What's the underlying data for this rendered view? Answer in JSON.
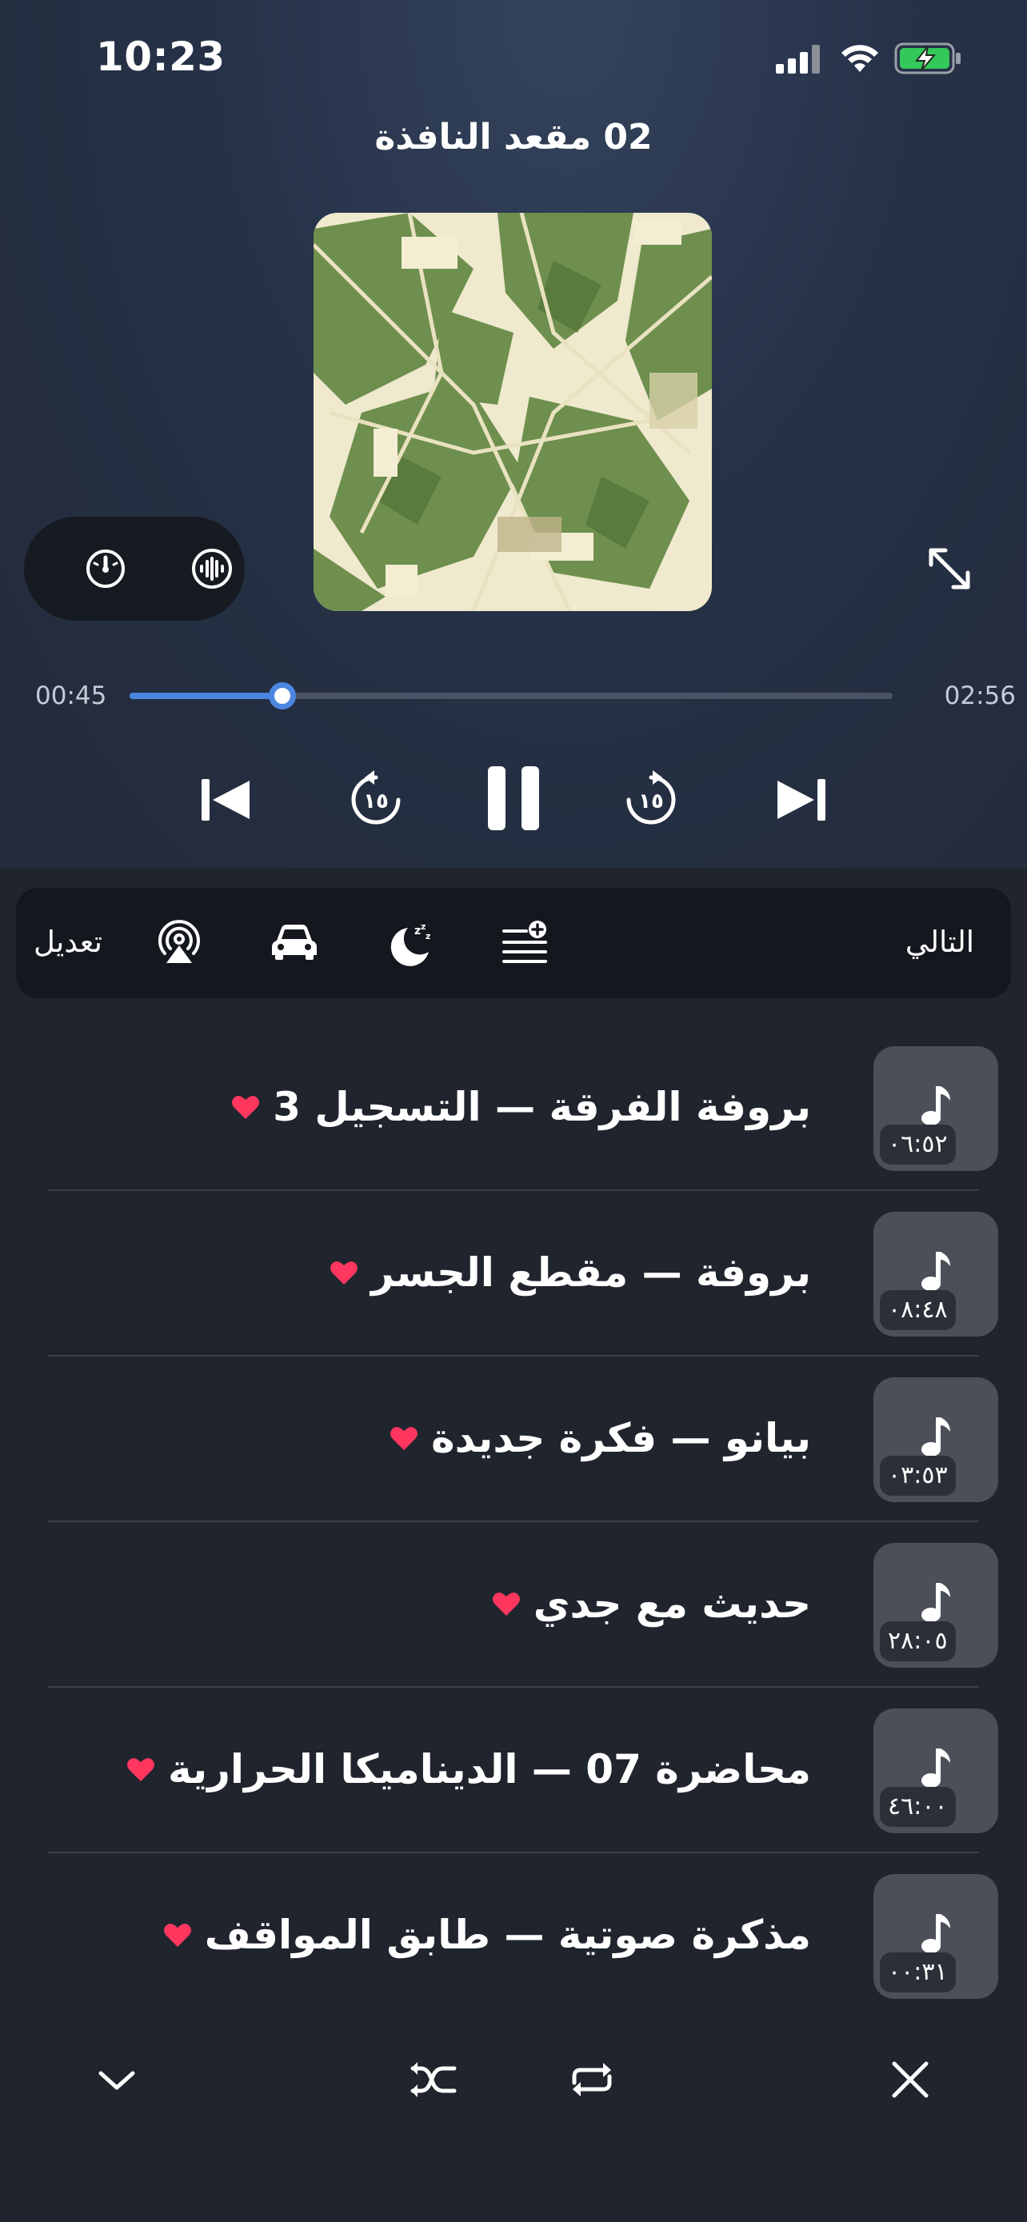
{
  "status_bar": {
    "time": "10:23",
    "battery_status": "charging"
  },
  "player": {
    "track_title": "02 مقعد النافذة",
    "elapsed": "00:45",
    "total": "02:56",
    "progress_fraction": 0.2
  },
  "colors": {
    "accent": "#4b86e0",
    "heart": "#ff375f",
    "battery": "#34c759",
    "toolbar_bg": "#14181e",
    "list_bg": "#1f242d"
  },
  "toolbar": {
    "edit_label": "تعديل",
    "next_label": "التالي",
    "icons": [
      "airplay-icon",
      "car-icon",
      "sleep-timer-icon",
      "add-to-queue-icon"
    ]
  },
  "queue": [
    {
      "title": "بروفة الفرقة — التسجيل 3",
      "duration": "٠٦:٥٢",
      "favorite": true
    },
    {
      "title": "بروفة — مقطع الجسر",
      "duration": "٠٨:٤٨",
      "favorite": true
    },
    {
      "title": "بيانو — فكرة جديدة",
      "duration": "٠٣:٥٣",
      "favorite": true
    },
    {
      "title": "حديث مع جدي",
      "duration": "٢٨:٠٥",
      "favorite": true
    },
    {
      "title": "محاضرة 07 — الديناميكا الحرارية",
      "duration": "٤٦:٠٠",
      "favorite": true
    },
    {
      "title": "مذكرة صوتية — طابق المواقف",
      "duration": "٠٠:٣١",
      "favorite": true
    }
  ]
}
